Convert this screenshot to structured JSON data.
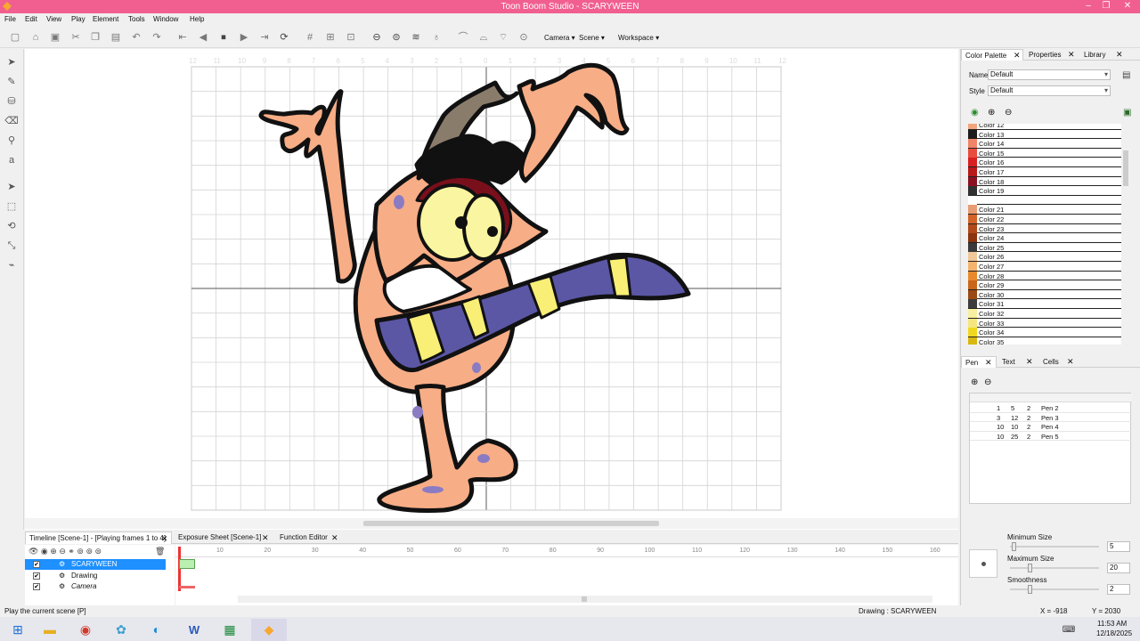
{
  "window": {
    "title": "Toon Boom Studio - SCARYWEEN"
  },
  "menu": [
    "File",
    "Edit",
    "View",
    "Play",
    "Element",
    "Tools",
    "Window",
    "Help"
  ],
  "toolbar": {
    "camera_label": "Camera",
    "scene_label": "Scene",
    "workspace_label": "Workspace"
  },
  "canvas": {
    "grid_numbers_top": [
      "12",
      "11",
      "10",
      "9",
      "8",
      "7",
      "6",
      "5",
      "4",
      "3",
      "2",
      "1",
      "0",
      "1",
      "2",
      "3",
      "4",
      "5",
      "6",
      "7",
      "8",
      "9",
      "10",
      "11",
      "12"
    ],
    "accent_colors": {
      "skin": "#f7ad86",
      "stripe_purple": "#5b57a5",
      "stripe_yellow": "#f9ef76",
      "hair": "#8a7c6b",
      "eye_red": "#7a0f1c",
      "outline": "#111111"
    }
  },
  "right_panel": {
    "tabs_top": [
      "Color Palette",
      "Properties",
      "Library"
    ],
    "name_label": "Name",
    "name_value": "Default",
    "style_label": "Style",
    "style_value": "Default",
    "colors": [
      {
        "name": "Color 12",
        "hex": "#f2a57d"
      },
      {
        "name": "Color 13",
        "hex": "#1c1c1c"
      },
      {
        "name": "Color 14",
        "hex": "#f08468"
      },
      {
        "name": "Color 15",
        "hex": "#e84c3d"
      },
      {
        "name": "Color 16",
        "hex": "#d82020"
      },
      {
        "name": "Color 17",
        "hex": "#b81818"
      },
      {
        "name": "Color 18",
        "hex": "#8a1020"
      },
      {
        "name": "Color 19",
        "hex": "#303030"
      },
      {
        "name": "",
        "hex": "#ffffff"
      },
      {
        "name": "Color 21",
        "hex": "#e89c74"
      },
      {
        "name": "Color 22",
        "hex": "#d2642a"
      },
      {
        "name": "Color 23",
        "hex": "#b04a1a"
      },
      {
        "name": "Color 24",
        "hex": "#8a3410"
      },
      {
        "name": "Color 25",
        "hex": "#3a3a3a"
      },
      {
        "name": "Color 26",
        "hex": "#f0c89a"
      },
      {
        "name": "Color 27",
        "hex": "#f5b46e"
      },
      {
        "name": "Color 28",
        "hex": "#e88a2c"
      },
      {
        "name": "Color 29",
        "hex": "#c8661a"
      },
      {
        "name": "Color 30",
        "hex": "#9a4a12"
      },
      {
        "name": "Color 31",
        "hex": "#3c3c3c"
      },
      {
        "name": "Color 32",
        "hex": "#f7f0a0"
      },
      {
        "name": "Color 33",
        "hex": "#f5e680"
      },
      {
        "name": "Color 34",
        "hex": "#f0d820"
      },
      {
        "name": "Color 35",
        "hex": "#d8b810"
      }
    ],
    "tabs_bottom": [
      "Pen",
      "Text",
      "Cells"
    ],
    "pens": [
      {
        "min": "1",
        "max": "5",
        "smooth": "2",
        "name": "Pen 2"
      },
      {
        "min": "3",
        "max": "12",
        "smooth": "2",
        "name": "Pen 3"
      },
      {
        "min": "10",
        "max": "10",
        "smooth": "2",
        "name": "Pen 4"
      },
      {
        "min": "10",
        "max": "25",
        "smooth": "2",
        "name": "Pen 5"
      }
    ],
    "min_size_label": "Minimum Size",
    "min_size_value": "5",
    "max_size_label": "Maximum Size",
    "max_size_value": "20",
    "smoothness_label": "Smoothness",
    "smoothness_value": "2"
  },
  "timeline": {
    "tabs": [
      "Timeline [Scene-1] - [Playing frames 1 to 4]",
      "Exposure Sheet [Scene-1]",
      "Function Editor"
    ],
    "layers": [
      {
        "name": "SCARYWEEN",
        "selected": true
      },
      {
        "name": "Drawing",
        "selected": false
      },
      {
        "name": "Camera",
        "selected": false
      }
    ],
    "ruler": [
      "10",
      "20",
      "30",
      "40",
      "50",
      "60",
      "70",
      "80",
      "90",
      "100",
      "110",
      "120",
      "130",
      "140",
      "150",
      "160"
    ]
  },
  "status": {
    "hint": "Play the current scene [P]",
    "drawing": "Drawing : SCARYWEEN",
    "x": "X = -918",
    "y": "Y = 2030"
  },
  "taskbar": {
    "time": "11:53 AM",
    "date": "12/18/2025"
  }
}
